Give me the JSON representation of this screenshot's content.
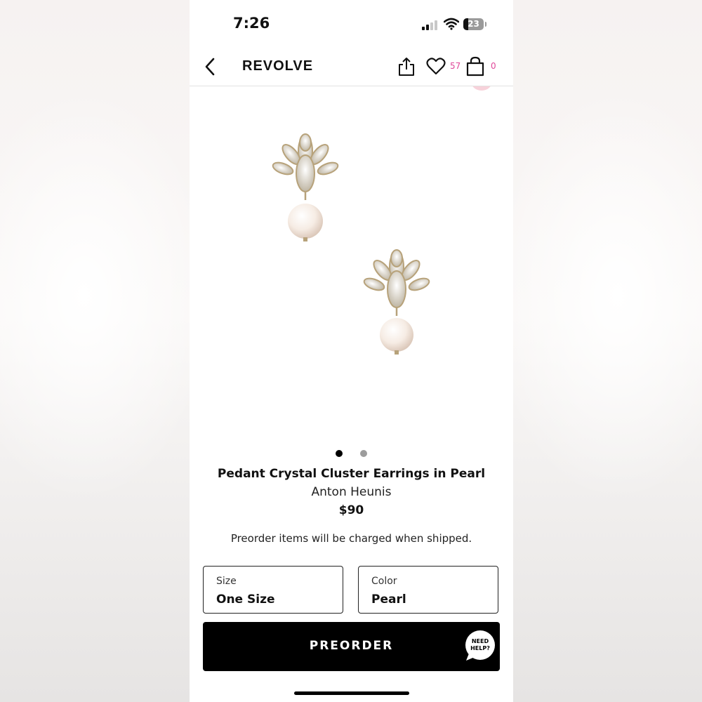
{
  "status_bar": {
    "time": "7:26",
    "battery_level": "23"
  },
  "nav": {
    "brand": "REVOLVE",
    "wishlist_count": "57",
    "bag_count": "0",
    "badge_color": "#e0489a"
  },
  "product": {
    "image_icon": "pearl-crystal-earrings-image",
    "image_count": 2,
    "active_image": 1,
    "title": "Pedant Crystal Cluster Earrings in Pearl",
    "brand": "Anton Heunis",
    "price": "$90",
    "preorder_note": "Preorder items will be charged when shipped."
  },
  "options": {
    "size_label": "Size",
    "size_value": "One Size",
    "color_label": "Color",
    "color_value": "Pearl"
  },
  "cta": {
    "label": "PREORDER",
    "help_line1": "NEED",
    "help_line2": "HELP?"
  }
}
